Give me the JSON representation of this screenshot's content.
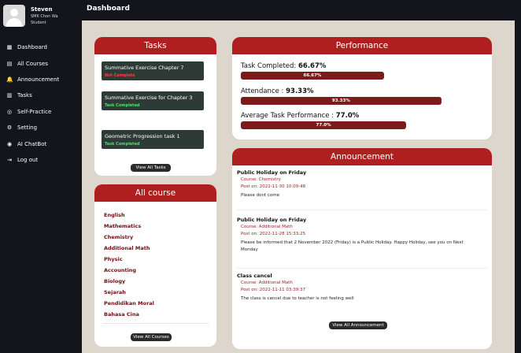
{
  "user": {
    "name": "Steven",
    "school": "SMK Chon Wa",
    "role": "Student"
  },
  "nav": [
    {
      "icon": "▦",
      "label": "Dashboard"
    },
    {
      "icon": "▤",
      "label": "All Courses"
    },
    {
      "icon": "🔔",
      "label": "Announcement"
    },
    {
      "icon": "▥",
      "label": "Tasks"
    },
    {
      "icon": "◎",
      "label": "Self-Practice"
    },
    {
      "icon": "⚙",
      "label": "Setting"
    },
    {
      "icon": "◉",
      "label": "AI ChatBot"
    },
    {
      "icon": "⇥",
      "label": "Log out"
    }
  ],
  "page_title": "Dashboard",
  "tasks": {
    "header": "Tasks",
    "items": [
      {
        "title": "Summative Exercise Chapter 7",
        "status": "Not Complete"
      },
      {
        "title": "Summative Exercise for Chapter 3",
        "status": "Task Completed"
      },
      {
        "title": "Geometric Progression task 1",
        "status": "Task Completed"
      }
    ],
    "view_all_label": "View All Tasks"
  },
  "courses": {
    "header": "All course",
    "items": [
      "English",
      "Mathematics",
      "Chemistry",
      "Additional Math",
      "Physic",
      "Accounting",
      "Biology",
      "Sejarah",
      "Pendidikan Moral",
      "Bahasa Cina"
    ],
    "view_all_label": "View All Courses"
  },
  "performance": {
    "header": "Performance",
    "rows": [
      {
        "label": "Task Completed: ",
        "value_text": "66.67%",
        "bar_text": "66.67%",
        "percent": 66.67
      },
      {
        "label": "Attendance : ",
        "value_text": "93.33%",
        "bar_text": "93.33%",
        "percent": 93.33
      },
      {
        "label": "Average Task Performance : ",
        "value_text": "77.0%",
        "bar_text": "77.0%",
        "percent": 77.0
      }
    ]
  },
  "announcements": {
    "header": "Announcement",
    "items": [
      {
        "title": "Public Holiday on Friday",
        "course": "Course: Chemistry",
        "posted": "Post on: 2022-11-30 10:09:48",
        "body": "Please dont come"
      },
      {
        "title": "Public Holiday on Friday",
        "course": "Course: Additional Math",
        "posted": "Post on: 2022-11-28 15:33:25",
        "body": "Please be informed that 2 November 2022 (Friday) is a Public Holiday. Happy Holiday, see you on Next Monday"
      },
      {
        "title": "Class cancel",
        "course": "Course: Additional Math",
        "posted": "Post on: 2022-11-11 03:39:37",
        "body": "The class is cancel due to teacher is not feeling well"
      }
    ],
    "view_all_label": "View All Announcement"
  },
  "colors": {
    "accent": "#b01f1f",
    "bar": "#7d1a1a",
    "sidebar": "#13141c",
    "main_bg": "#dcd6cc"
  }
}
